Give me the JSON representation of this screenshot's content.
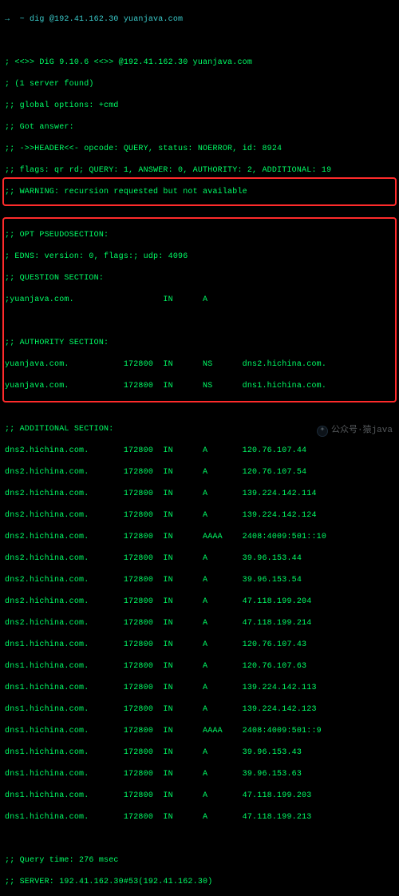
{
  "prompt": {
    "arrow": "→",
    "tilde": "~",
    "command": "dig @192.41.162.30 yuanjava.com"
  },
  "header": {
    "l1": "; <<>> DiG 9.10.6 <<>> @192.41.162.30 yuanjava.com",
    "l2": "; (1 server found)",
    "l3": ";; global options: +cmd",
    "l4": ";; Got answer:",
    "l5": ";; ->>HEADER<<- opcode: QUERY, status: NOERROR, id: 8924",
    "l6": ";; flags: qr rd; QUERY: 1, ANSWER: 0, AUTHORITY: 2, ADDITIONAL: 19",
    "l7": ";; WARNING: recursion requested but not available"
  },
  "opt": {
    "h": ";; OPT PSEUDOSECTION:",
    "l1": "; EDNS: version: 0, flags:; udp: 4096"
  },
  "question": {
    "h": ";; QUESTION SECTION:",
    "row": ";yuanjava.com.                  IN      A"
  },
  "authority": {
    "h": ";; AUTHORITY SECTION:",
    "rows": [
      "yuanjava.com.           172800  IN      NS      dns2.hichina.com.",
      "yuanjava.com.           172800  IN      NS      dns1.hichina.com."
    ]
  },
  "additional": {
    "h": ";; ADDITIONAL SECTION:",
    "rows": [
      "dns2.hichina.com.       172800  IN      A       120.76.107.44",
      "dns2.hichina.com.       172800  IN      A       120.76.107.54",
      "dns2.hichina.com.       172800  IN      A       139.224.142.114",
      "dns2.hichina.com.       172800  IN      A       139.224.142.124",
      "dns2.hichina.com.       172800  IN      AAAA    2408:4009:501::10",
      "dns2.hichina.com.       172800  IN      A       39.96.153.44",
      "dns2.hichina.com.       172800  IN      A       39.96.153.54",
      "dns2.hichina.com.       172800  IN      A       47.118.199.204",
      "dns2.hichina.com.       172800  IN      A       47.118.199.214",
      "dns1.hichina.com.       172800  IN      A       120.76.107.43",
      "dns1.hichina.com.       172800  IN      A       120.76.107.63",
      "dns1.hichina.com.       172800  IN      A       139.224.142.113",
      "dns1.hichina.com.       172800  IN      A       139.224.142.123",
      "dns1.hichina.com.       172800  IN      AAAA    2408:4009:501::9",
      "dns1.hichina.com.       172800  IN      A       39.96.153.43",
      "dns1.hichina.com.       172800  IN      A       39.96.153.63",
      "dns1.hichina.com.       172800  IN      A       47.118.199.203",
      "dns1.hichina.com.       172800  IN      A       47.118.199.213"
    ]
  },
  "footer": {
    "l1": ";; Query time: 276 msec",
    "l2": ";; SERVER: 192.41.162.30#53(192.41.162.30)"
  },
  "watermark": {
    "icon": "✦",
    "text": "公众号·猿java"
  }
}
